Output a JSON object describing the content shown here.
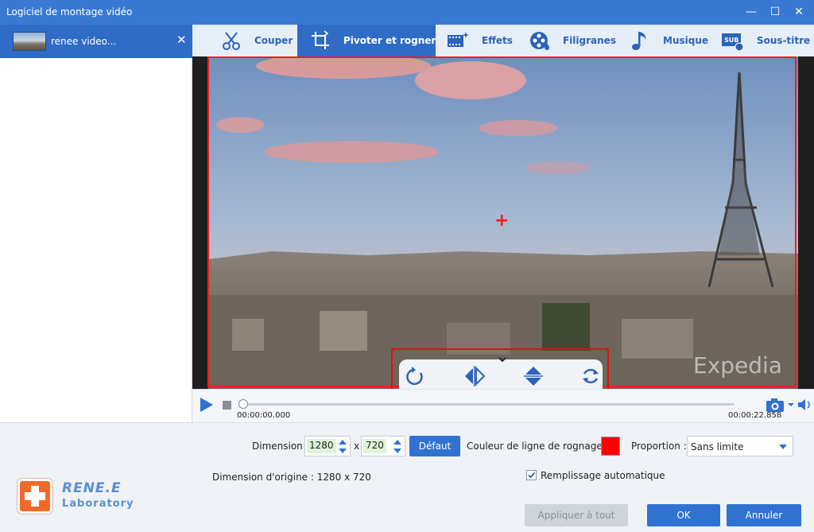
{
  "window": {
    "title": "Logiciel de montage vidéo",
    "minimize": "—",
    "maximize": "☐",
    "close": "✕"
  },
  "file_tab": {
    "name": "renee video...",
    "close": "✕"
  },
  "toolbar": {
    "tabs": [
      {
        "label": "Couper",
        "icon": "scissors-icon"
      },
      {
        "label": "Pivoter et rogner",
        "icon": "crop-icon",
        "active": true
      },
      {
        "label": "Effets",
        "icon": "film-sparkle-icon"
      },
      {
        "label": "Filigranes",
        "icon": "watermark-film-icon"
      },
      {
        "label": "Musique",
        "icon": "music-note-icon"
      },
      {
        "label": "Sous-titre",
        "icon": "subtitle-icon"
      }
    ]
  },
  "video": {
    "watermark": "Expedia",
    "crop_line_color": "#ff1a1a"
  },
  "rotate_controls": [
    "rotate-clockwise-icon",
    "flip-horizontal-icon",
    "flip-vertical-icon",
    "rotate-reset-icon"
  ],
  "player": {
    "current_time": "00:00:00.000",
    "total_time": "00:00:22.858",
    "progress": 0
  },
  "settings": {
    "dimension_label": "Dimension :",
    "width": "1280",
    "x_sep": "x",
    "height": "720",
    "default_button": "Défaut",
    "crop_color_label": "Couleur de ligne de rognage :",
    "crop_color": "#ff0000",
    "proportion_label": "Proportion :",
    "proportion_value": "Sans limite",
    "original_dimension": "Dimension d'origine : 1280 x 720",
    "auto_fill_label": "Remplissage automatique",
    "auto_fill_checked": true
  },
  "footer": {
    "apply_all": "Appliquer à tout",
    "ok": "OK",
    "cancel": "Annuler"
  },
  "brand": {
    "line1": "RENE.E",
    "line2": "Laboratory"
  }
}
